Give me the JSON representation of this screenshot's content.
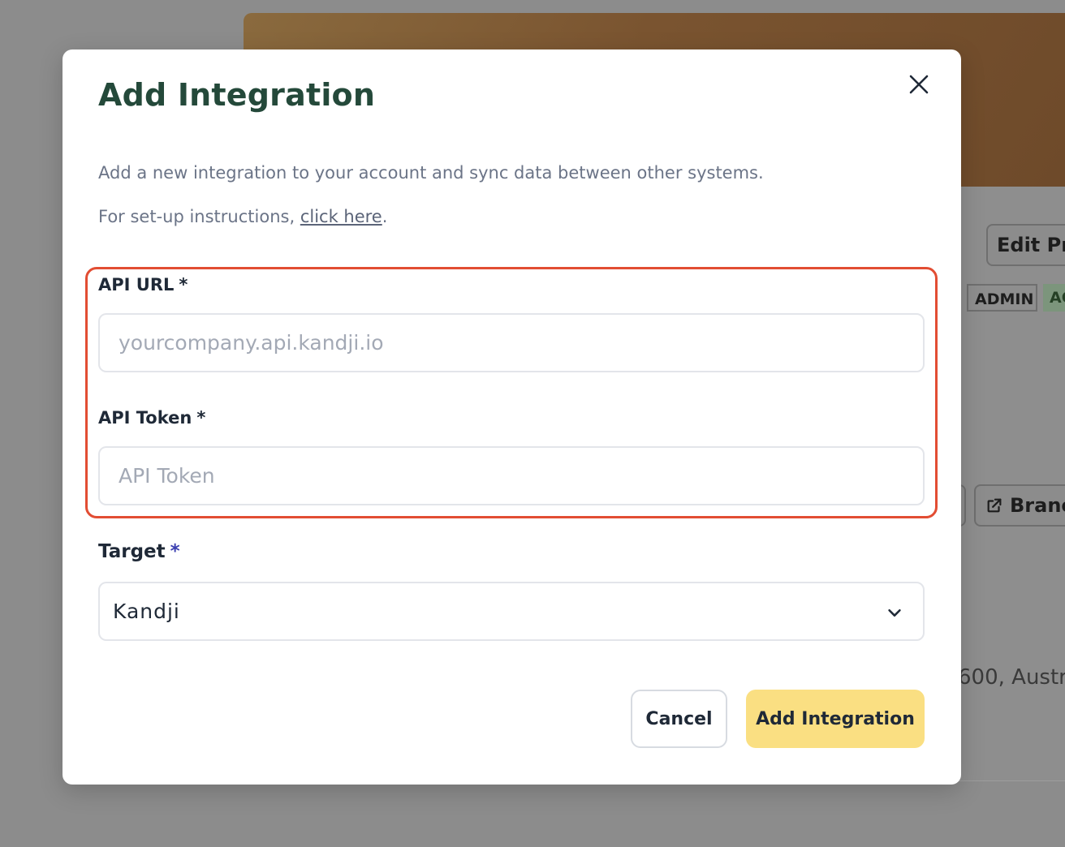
{
  "background": {
    "edit_button": "Edit Pro",
    "badges": [
      "ADMIN",
      "AC"
    ],
    "branch_button": "Branc",
    "address_fragment": "600, Austr"
  },
  "modal": {
    "title": "Add Integration",
    "description": "Add a new integration to your account and sync data between other systems.",
    "instructions_prefix": "For set-up instructions, ",
    "instructions_link": "click here",
    "instructions_suffix": ".",
    "fields": {
      "api_url": {
        "label": "API URL",
        "required_mark": "*",
        "value": "",
        "placeholder": "yourcompany.api.kandji.io"
      },
      "api_token": {
        "label": "API Token",
        "required_mark": "*",
        "value": "",
        "placeholder": "API Token"
      },
      "target": {
        "label": "Target",
        "required_mark": "*",
        "selected": "Kandji"
      }
    },
    "buttons": {
      "cancel": "Cancel",
      "submit": "Add Integration"
    }
  },
  "colors": {
    "title": "#24493a",
    "highlight_border": "#e24d33",
    "primary_button": "#fadf82",
    "overlay": "#8c8c8c"
  },
  "icons": [
    "close-icon",
    "chevron-down-icon",
    "external-link-icon"
  ]
}
